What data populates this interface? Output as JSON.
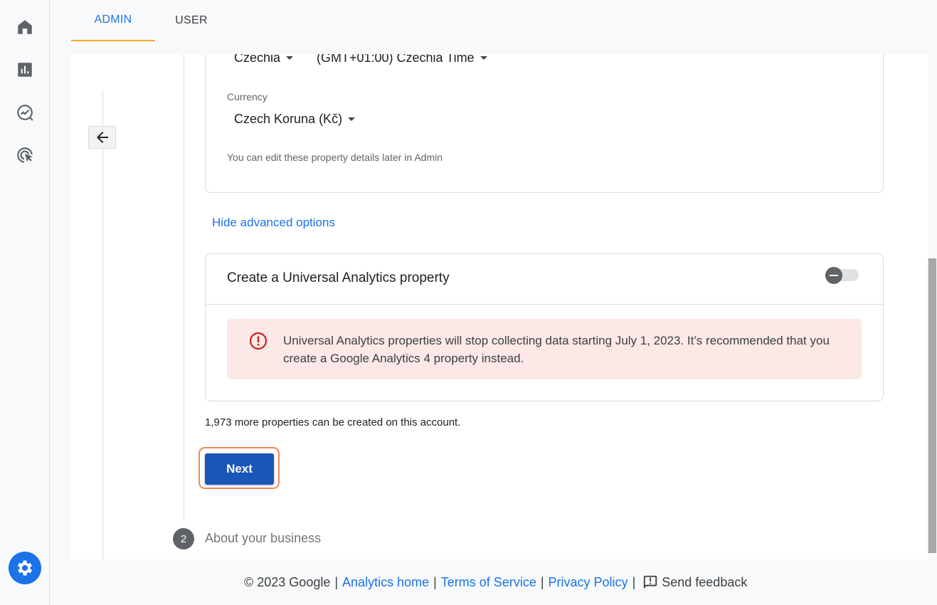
{
  "tabs": {
    "admin": "ADMIN",
    "user": "USER"
  },
  "property": {
    "country": "Czechia",
    "timezone": "(GMT+01:00) Czechia Time",
    "currency_label": "Currency",
    "currency": "Czech Koruna (Kč)",
    "edit_note": "You can edit these property details later in Admin"
  },
  "advanced_link": "Hide advanced options",
  "ua_card": {
    "title": "Create a Universal Analytics property",
    "warning": "Universal Analytics properties will stop collecting data starting July 1, 2023. It’s recommended that you create a Google Analytics 4 property instead."
  },
  "more_properties": "1,973 more properties can be created on this account.",
  "next_button": "Next",
  "step2": {
    "number": "2",
    "label": "About your business"
  },
  "footer": {
    "copyright": "© 2023 Google",
    "analytics_home": "Analytics home",
    "terms": "Terms of Service",
    "privacy": "Privacy Policy",
    "feedback": "Send feedback"
  },
  "colors": {
    "accent": "#1a73e8",
    "next_button": "#1a56b8",
    "warning_bg": "#fce8e6",
    "warning_icon": "#c5221f",
    "highlight": "#f4845f"
  },
  "icons": [
    "home-icon",
    "reports-icon",
    "explore-icon",
    "advertising-icon",
    "admin-gear-icon",
    "back-arrow-icon",
    "error-icon",
    "feedback-icon"
  ]
}
